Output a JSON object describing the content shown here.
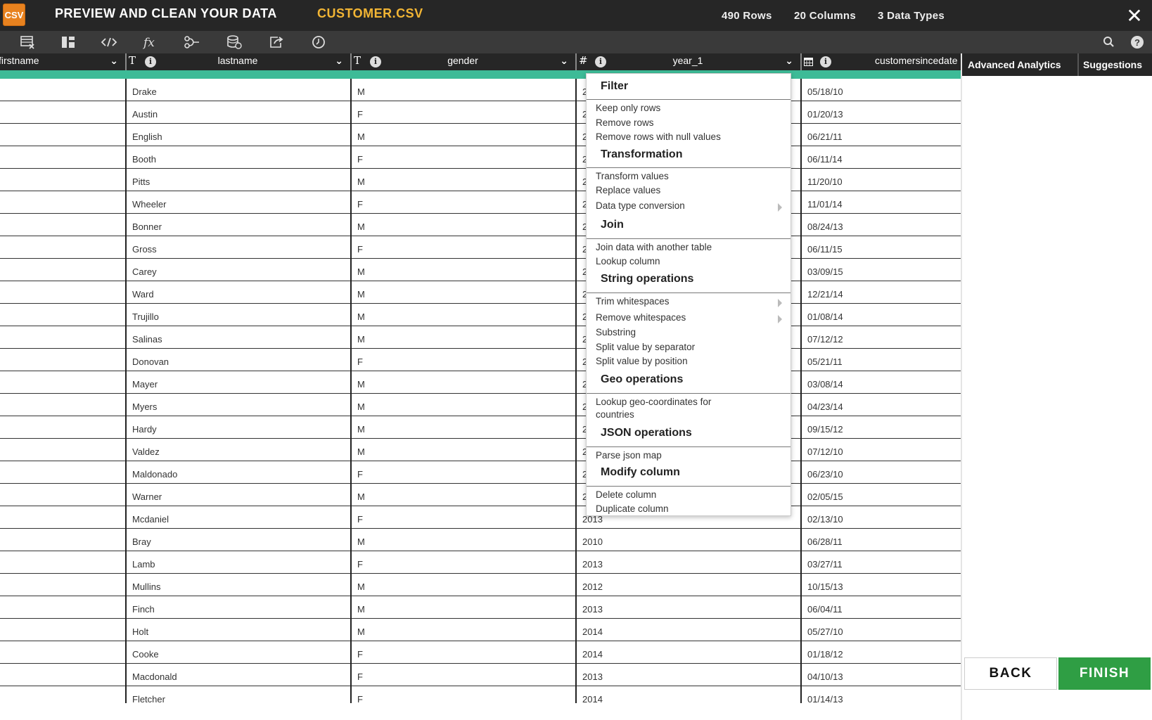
{
  "app": {
    "logo_text": "CSV",
    "title": "PREVIEW AND CLEAN YOUR DATA",
    "file_name": "CUSTOMER.CSV",
    "rows": "490 Rows",
    "columns": "20 Columns",
    "data_types": "3 Data Types",
    "close_glyph": "✕"
  },
  "toolbar": {
    "icons": [
      "table-edit-icon",
      "column-layout-icon",
      "code-icon",
      "function-icon",
      "join-icon",
      "database-add-icon",
      "export-icon",
      "history-icon"
    ],
    "search_icon": "search-icon",
    "help_label": "?"
  },
  "columns": [
    {
      "name": "firstname",
      "type_glyph": "",
      "info": false
    },
    {
      "name": "lastname",
      "type_glyph": "T",
      "info": true
    },
    {
      "name": "gender",
      "type_glyph": "T",
      "info": true
    },
    {
      "name": "year_1",
      "type_glyph": "#",
      "info": true
    },
    {
      "name": "customersincedate",
      "type_glyph": "calendar",
      "info": true
    }
  ],
  "table": {
    "lastname": [
      "Drake",
      "Austin",
      "English",
      "Booth",
      "Pitts",
      "Wheeler",
      "Bonner",
      "Gross",
      "Carey",
      "Ward",
      "Trujillo",
      "Salinas",
      "Donovan",
      "Mayer",
      "Myers",
      "Hardy",
      "Valdez",
      "Maldonado",
      "Warner",
      "Mcdaniel",
      "Bray",
      "Lamb",
      "Mullins",
      "Finch",
      "Holt",
      "Cooke",
      "Macdonald",
      "Fletcher"
    ],
    "gender": [
      "M",
      "F",
      "M",
      "F",
      "M",
      "F",
      "M",
      "F",
      "M",
      "M",
      "M",
      "M",
      "F",
      "M",
      "M",
      "M",
      "M",
      "F",
      "M",
      "F",
      "M",
      "F",
      "M",
      "M",
      "M",
      "F",
      "F",
      "F"
    ],
    "year_1": [
      "2",
      "2",
      "2",
      "2",
      "2",
      "2",
      "2",
      "2",
      "2",
      "2",
      "2",
      "2",
      "2",
      "2",
      "2",
      "2",
      "2",
      "2",
      "2",
      "2013",
      "2010",
      "2013",
      "2012",
      "2013",
      "2014",
      "2014",
      "2013",
      "2014"
    ],
    "customersincedate": [
      "05/18/10",
      "01/20/13",
      "06/21/11",
      "06/11/14",
      "11/20/10",
      "11/01/14",
      "08/24/13",
      "06/11/15",
      "03/09/15",
      "12/21/14",
      "01/08/14",
      "07/12/12",
      "05/21/11",
      "03/08/14",
      "04/23/14",
      "09/15/12",
      "07/12/10",
      "06/23/10",
      "02/05/15",
      "02/13/10",
      "06/28/11",
      "03/27/11",
      "10/15/13",
      "06/04/11",
      "05/27/10",
      "01/18/12",
      "04/10/13",
      "01/14/13"
    ]
  },
  "menu": {
    "sections": [
      {
        "title": "Filter",
        "items": [
          "Keep only rows",
          "Remove rows",
          "Remove rows with null values"
        ]
      },
      {
        "title": "Transformation",
        "items": [
          "Transform values",
          "Replace values",
          "Data type conversion"
        ]
      },
      {
        "title": "Join",
        "items": [
          "Join data with another table",
          "Lookup column"
        ]
      },
      {
        "title": "String operations",
        "items": [
          "Trim whitespaces",
          "Remove whitespaces",
          "Substring",
          "Split value by separator",
          "Split value by position"
        ]
      },
      {
        "title": "Geo operations",
        "items": [
          "Lookup geo-coordinates for countries"
        ]
      },
      {
        "title": "JSON operations",
        "items": [
          "Parse json map"
        ]
      },
      {
        "title": "Modify column",
        "items": [
          "Delete column",
          "Duplicate column"
        ]
      }
    ]
  },
  "panel": {
    "tab_analytics": "Advanced Analytics",
    "tab_suggestions": "Suggestions",
    "back_label": "BACK",
    "finish_label": "FINISH"
  },
  "colors": {
    "quality_bar": "#3dbb97",
    "file_name": "#f2b534",
    "logo": "#e8821f",
    "finish": "#2f9e44"
  }
}
